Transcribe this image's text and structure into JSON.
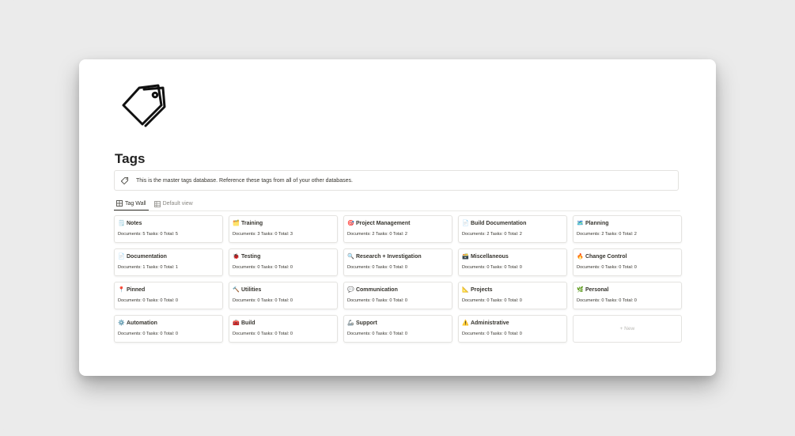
{
  "page": {
    "title": "Tags",
    "icon": "price-tag-outline-icon",
    "callout": {
      "icon": "tag-icon",
      "text": "This is the master tags database. Reference these tags from all of your other databases."
    }
  },
  "views": {
    "tabs": [
      {
        "label": "Tag Wall",
        "icon": "gallery-icon",
        "active": true
      },
      {
        "label": "Default view",
        "icon": "table-icon",
        "active": false
      }
    ]
  },
  "cards": [
    {
      "emoji": "🗒️",
      "icon": "notepad-icon",
      "title": "Notes",
      "stats": "Documents: 5 Tasks: 0 Total: 5"
    },
    {
      "emoji": "🗂️",
      "icon": "card-index-dividers-icon",
      "title": "Training",
      "stats": "Documents: 3 Tasks: 0 Total: 3"
    },
    {
      "emoji": "🎯",
      "icon": "direct-hit-icon",
      "title": "Project Management",
      "stats": "Documents: 2 Tasks: 0 Total: 2"
    },
    {
      "emoji": "📄",
      "icon": "page-icon",
      "title": "Build Documentation",
      "stats": "Documents: 2 Tasks: 0 Total: 2"
    },
    {
      "emoji": "🗺️",
      "icon": "world-map-icon",
      "title": "Planning",
      "stats": "Documents: 2 Tasks: 0 Total: 2"
    },
    {
      "emoji": "📄",
      "icon": "page-icon",
      "title": "Documentation",
      "stats": "Documents: 1 Tasks: 0 Total: 1"
    },
    {
      "emoji": "🐞",
      "icon": "bug-icon",
      "title": "Testing",
      "stats": "Documents: 0 Tasks: 0 Total: 0"
    },
    {
      "emoji": "🔍",
      "icon": "magnifying-glass-icon",
      "title": "Research + Investigation",
      "stats": "Documents: 0 Tasks: 0 Total: 0"
    },
    {
      "emoji": "🗃️",
      "icon": "card-file-box-icon",
      "title": "Miscellaneous",
      "stats": "Documents: 0 Tasks: 0 Total: 0"
    },
    {
      "emoji": "🔥",
      "icon": "fire-icon",
      "title": "Change Control",
      "stats": "Documents: 0 Tasks: 0 Total: 0"
    },
    {
      "emoji": "📍",
      "icon": "pushpin-icon",
      "title": "Pinned",
      "stats": "Documents: 0 Tasks: 0 Total: 0"
    },
    {
      "emoji": "🔨",
      "icon": "hammer-icon",
      "title": "Utilities",
      "stats": "Documents: 0 Tasks: 0 Total: 0"
    },
    {
      "emoji": "💬",
      "icon": "speech-bubble-icon",
      "title": "Communication",
      "stats": "Documents: 0 Tasks: 0 Total: 0"
    },
    {
      "emoji": "📐",
      "icon": "triangular-ruler-icon",
      "title": "Projects",
      "stats": "Documents: 0 Tasks: 0 Total: 0"
    },
    {
      "emoji": "🌿",
      "icon": "herb-icon",
      "title": "Personal",
      "stats": "Documents: 0 Tasks: 0 Total: 0"
    },
    {
      "emoji": "⚙️",
      "icon": "gear-icon",
      "title": "Automation",
      "stats": "Documents: 0 Tasks: 0 Total: 0"
    },
    {
      "emoji": "🧰",
      "icon": "toolbox-icon",
      "title": "Build",
      "stats": "Documents: 0 Tasks: 0 Total: 0"
    },
    {
      "emoji": "🦾",
      "icon": "mechanical-arm-icon",
      "title": "Support",
      "stats": "Documents: 0 Tasks: 0 Total: 0"
    },
    {
      "emoji": "⚠️",
      "icon": "warning-icon",
      "title": "Administrative",
      "stats": "Documents: 0 Tasks: 0 Total: 0"
    }
  ],
  "new_card": {
    "label": "+ New"
  },
  "colors": {
    "text": "#37352f",
    "muted": "#8a8883",
    "border": "#e4e3e0",
    "background": "#ebebeb"
  }
}
